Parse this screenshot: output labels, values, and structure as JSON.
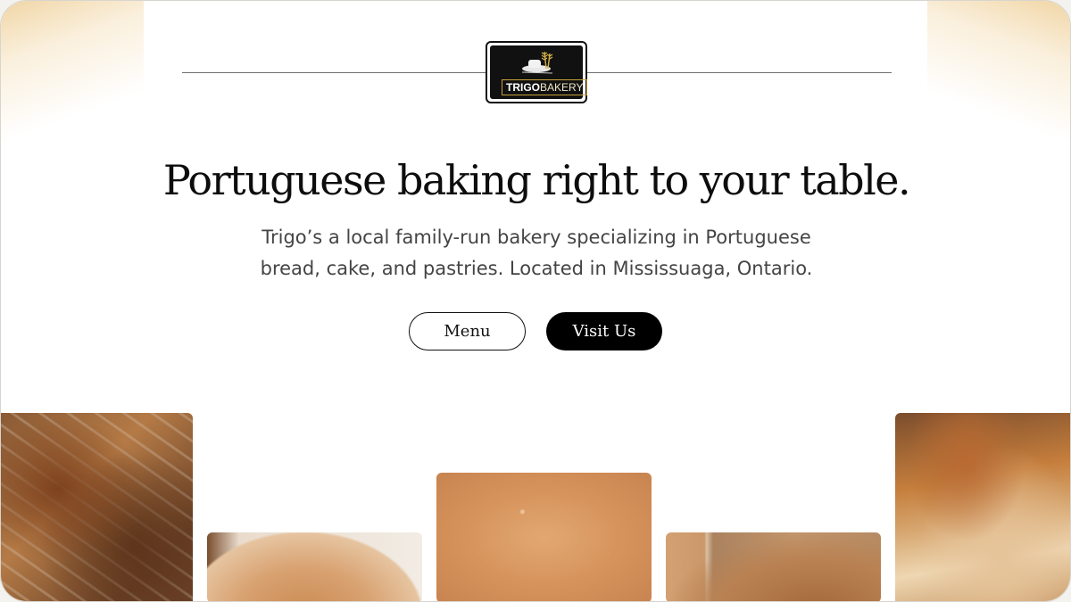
{
  "brand": {
    "name_bold": "TRIGO",
    "name_light": "BAKERY",
    "accent_color": "#c9a13c"
  },
  "hero": {
    "headline": "Portuguese baking right to your table.",
    "subheadline": "Trigo’s a local family-run bakery specializing in Portuguese bread, cake, and pastries. Located in Mississuaga, Ontario."
  },
  "actions": {
    "menu_label": "Menu",
    "visit_label": "Visit Us"
  },
  "gallery": [
    {
      "description": "bread-crust-photo"
    },
    {
      "description": "round-loaf-photo"
    },
    {
      "description": "bread-top-photo"
    },
    {
      "description": "bread-rolls-photo"
    },
    {
      "description": "rustic-bread-photo"
    }
  ]
}
